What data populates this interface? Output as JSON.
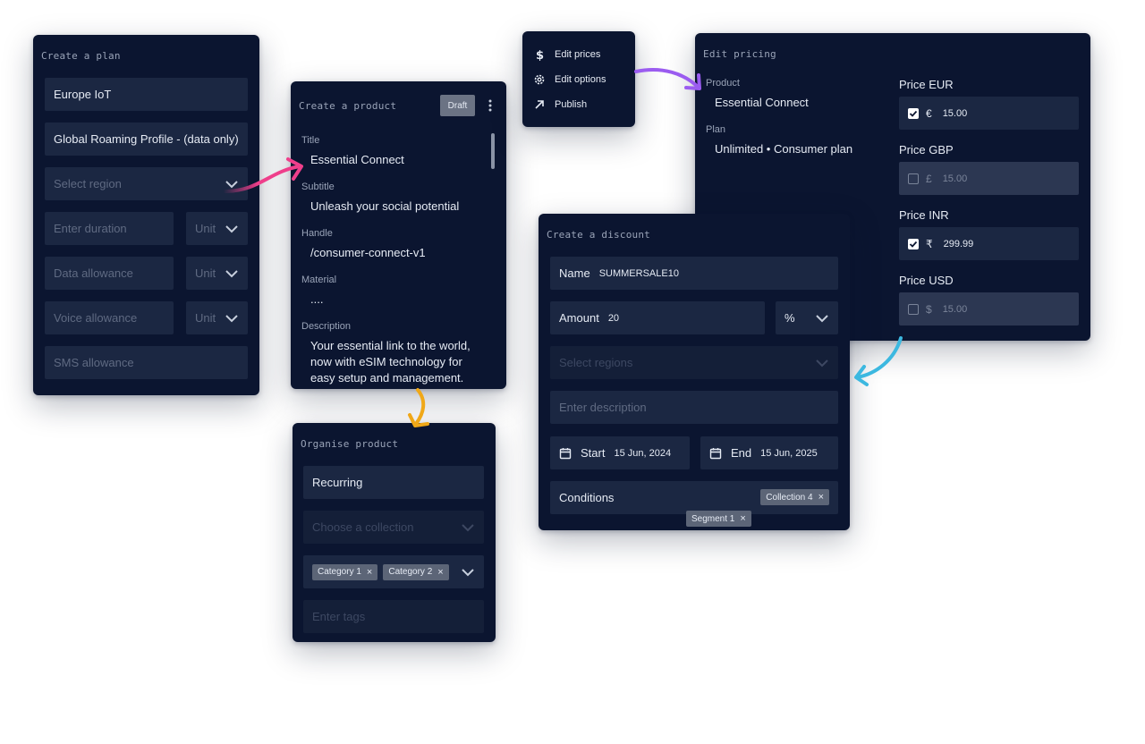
{
  "plan": {
    "title": "Create a plan",
    "plan_name": "Europe IoT",
    "profile": "Global Roaming Profile - (data only)",
    "region_placeholder": "Select region",
    "duration_placeholder": "Enter duration",
    "data_placeholder": "Data allowance",
    "voice_placeholder": "Voice allowance",
    "sms_placeholder": "SMS allowance",
    "unit_label": "Unit"
  },
  "product": {
    "title": "Create a product",
    "badge": "Draft",
    "title_label": "Title",
    "title_value": "Essential Connect",
    "subtitle_label": "Subtitle",
    "subtitle_value": "Unleash your social potential",
    "handle_label": "Handle",
    "handle_value": "/consumer-connect-v1",
    "material_label": "Material",
    "material_value": "....",
    "description_label": "Description",
    "description_value": "Your essential link to the world, now with eSIM technology for easy setup and management."
  },
  "menu": {
    "items": [
      {
        "label": "Edit prices",
        "icon": "dollar-icon"
      },
      {
        "label": "Edit options",
        "icon": "gear-icon"
      },
      {
        "label": "Publish",
        "icon": "arrow-up-right-icon"
      }
    ]
  },
  "pricing": {
    "title": "Edit pricing",
    "product_label": "Product",
    "product_value": "Essential Connect",
    "plan_label": "Plan",
    "plan_value": "Unlimited • Consumer plan",
    "prices": [
      {
        "label": "Price EUR",
        "symbol": "€",
        "amount": "15.00",
        "checked": true
      },
      {
        "label": "Price GBP",
        "symbol": "£",
        "amount": "15.00",
        "checked": false
      },
      {
        "label": "Price INR",
        "symbol": "₹",
        "amount": "299.99",
        "checked": true
      },
      {
        "label": "Price USD",
        "symbol": "$",
        "amount": "15.00",
        "checked": false
      }
    ]
  },
  "discount": {
    "title": "Create a discount",
    "name_label": "Name",
    "name_value": "SUMMERSALE10",
    "amount_label": "Amount",
    "amount_value": "20",
    "amount_unit": "%",
    "regions_placeholder": "Select regions",
    "description_placeholder": "Enter description",
    "start_label": "Start",
    "start_value": "15 Jun, 2024",
    "end_label": "End",
    "end_value": "15 Jun, 2025",
    "conditions_label": "Conditions",
    "chip_collection": "Collection 4",
    "chip_segment": "Segment 1"
  },
  "organise": {
    "title": "Organise product",
    "type_value": "Recurring",
    "collection_placeholder": "Choose a collection",
    "category_1": "Category 1",
    "category_2": "Category 2",
    "tags_placeholder": "Enter tags"
  },
  "colors": {
    "panel_bg": "#0b1530",
    "field_bg": "#1b2742",
    "arrow_pink": "#ef3f8b",
    "arrow_purple": "#9b5cf0",
    "arrow_yellow": "#f0a818",
    "arrow_cyan": "#3cb8e0"
  }
}
